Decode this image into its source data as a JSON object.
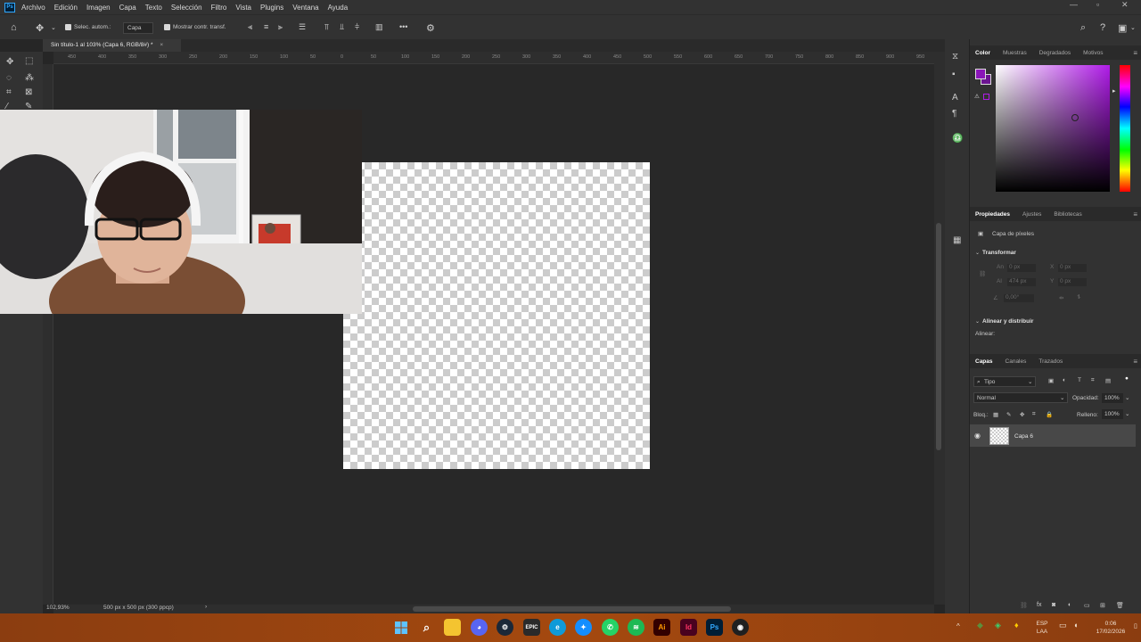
{
  "menubar": {
    "logo": "Ps",
    "items": [
      "Archivo",
      "Edición",
      "Imagen",
      "Capa",
      "Texto",
      "Selección",
      "Filtro",
      "Vista",
      "Plugins",
      "Ventana",
      "Ayuda"
    ]
  },
  "options": {
    "auto_select_label": "Selec. autom.:",
    "auto_select_value": "Capa",
    "show_transform_label": "Mostrar contr. transf.",
    "more": "•••"
  },
  "document": {
    "tab_title": "Sin título-1 al 103% (Capa 6, RGB/8#) *",
    "close": "×"
  },
  "ruler": {
    "top_ticks": [
      "450",
      "400",
      "350",
      "300",
      "250",
      "200",
      "150",
      "100",
      "50",
      "0",
      "50",
      "100",
      "150",
      "200",
      "250",
      "300",
      "350",
      "400",
      "450",
      "500",
      "550",
      "600",
      "650",
      "700",
      "750",
      "800",
      "850",
      "900",
      "950"
    ]
  },
  "status": {
    "zoom": "102,93%",
    "doc_size": "500 px x 500 px (300 ppcp)",
    "arrow": "›"
  },
  "color_panel": {
    "tabs": [
      "Color",
      "Muestras",
      "Degradados",
      "Motivos"
    ],
    "fg_color": "#8a16b8",
    "bg_color": "#6b1590"
  },
  "properties_panel": {
    "tabs": [
      "Propiedades",
      "Ajustes",
      "Bibliotecas"
    ],
    "layer_type": "Capa de píxeles",
    "transform_title": "Transformar",
    "w_label": "An",
    "w_value": "0 px",
    "x_label": "X",
    "x_value": "0 px",
    "h_label": "Al",
    "h_value": "474 px",
    "y_label": "Y",
    "y_value": "0 px",
    "angle_value": "0,00°",
    "align_title": "Alinear y distribuir",
    "align_label": "Alinear:"
  },
  "layers_panel": {
    "tabs": [
      "Capas",
      "Canales",
      "Trazados"
    ],
    "filter_label": "Tipo",
    "blend_mode": "Normal",
    "opacity_label": "Opacidad:",
    "opacity_value": "100%",
    "lock_label": "Bloq.:",
    "fill_label": "Relleno:",
    "fill_value": "100%",
    "layers": [
      {
        "name": "Capa 6",
        "visible": true
      }
    ]
  },
  "taskbar": {
    "apps": [
      "windows-start",
      "search",
      "file-explorer",
      "discord",
      "steam",
      "epic-games",
      "edge",
      "battle-net",
      "whatsapp",
      "spotify",
      "illustrator",
      "indesign",
      "photoshop",
      "obs"
    ],
    "ai_label": "Ai",
    "id_label": "Id",
    "ps_label": "Ps",
    "lang_top": "ESP",
    "lang_bottom": "LAA",
    "time": "0:06",
    "date": "17/02/2026"
  }
}
